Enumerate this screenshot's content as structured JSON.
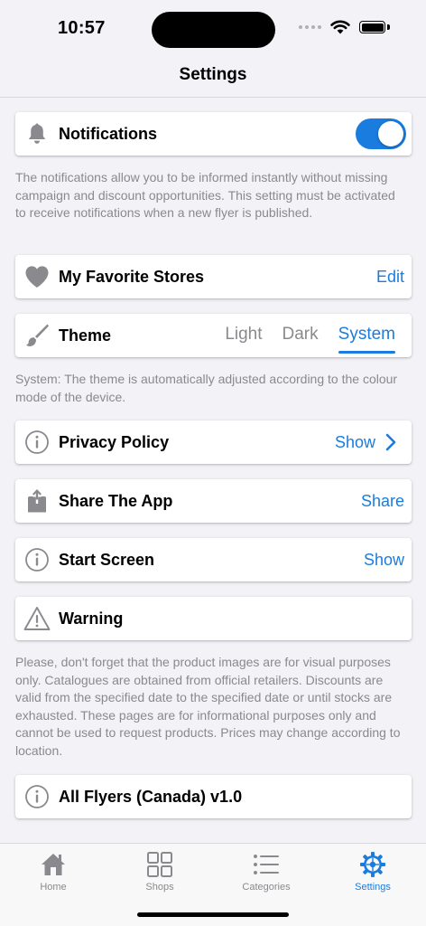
{
  "status_bar": {
    "time": "10:57"
  },
  "nav": {
    "title": "Settings"
  },
  "notifications": {
    "label": "Notifications",
    "enabled": true,
    "description": "The notifications allow you to be informed instantly without missing campaign and discount opportunities. This setting must be activated to receive notifications when a new flyer is published."
  },
  "favorites": {
    "label": "My Favorite Stores",
    "action": "Edit"
  },
  "theme": {
    "label": "Theme",
    "options": [
      "Light",
      "Dark",
      "System"
    ],
    "selected": "System",
    "description": "System: The theme is automatically adjusted according to the colour mode of the device."
  },
  "privacy": {
    "label": "Privacy Policy",
    "action": "Show"
  },
  "share": {
    "label": "Share The App",
    "action": "Share"
  },
  "start_screen": {
    "label": "Start Screen",
    "action": "Show"
  },
  "warning": {
    "label": "Warning",
    "description": "Please, don't forget that the product images are for visual purposes only. Catalogues are obtained from official retailers. Discounts are valid from the specified date to the specified date or until stocks are exhausted. These pages are for informational purposes only and cannot be used to request products. Prices may change according to location."
  },
  "version": {
    "label": "All Flyers (Canada) v1.0"
  },
  "tabbar": {
    "items": [
      {
        "label": "Home",
        "icon": "home-icon"
      },
      {
        "label": "Shops",
        "icon": "grid-icon"
      },
      {
        "label": "Categories",
        "icon": "list-icon"
      },
      {
        "label": "Settings",
        "icon": "gear-icon"
      }
    ],
    "active": "Settings"
  },
  "colors": {
    "accent": "#1a7cde",
    "background": "#f2f2f7",
    "secondary_text": "#8a8a8e"
  }
}
